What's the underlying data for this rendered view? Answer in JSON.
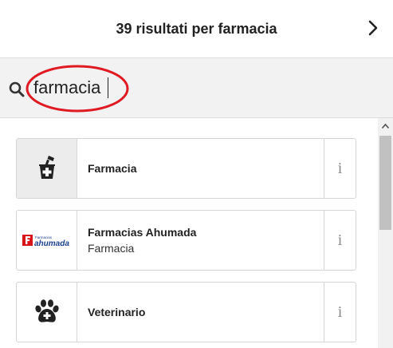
{
  "header": {
    "title": "39 risultati per farmacia",
    "next_icon": "chevron-right-icon"
  },
  "search": {
    "value": "farmacia",
    "icon": "search-icon",
    "annotation_color": "#e01a22"
  },
  "results": [
    {
      "name": "Farmacia",
      "subtitle": "",
      "icon": "pharmacy-mortar-icon",
      "info_label": "i"
    },
    {
      "name": "Farmacias Ahumada",
      "subtitle": "Farmacia",
      "icon": "farmacias-ahumada-logo",
      "logo_text": "ahumada",
      "logo_small_text": "Farmacias",
      "info_label": "i"
    },
    {
      "name": "Veterinario",
      "subtitle": "",
      "icon": "paw-icon",
      "info_label": "i"
    }
  ],
  "colors": {
    "search_bar_bg": "#f2f2f2",
    "logo_red": "#d7141a",
    "logo_blue": "#1d3f8f"
  }
}
